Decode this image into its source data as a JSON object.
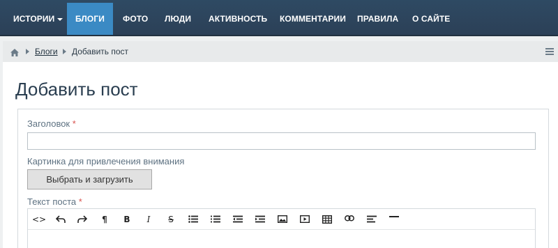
{
  "nav": {
    "items": [
      {
        "label": "ИСТОРИИ",
        "has_caret": true
      },
      {
        "label": "БЛОГИ",
        "active": true
      },
      {
        "label": "ФОТО"
      },
      {
        "label": "ЛЮДИ"
      },
      {
        "label": "АКТИВНОСТЬ"
      },
      {
        "label": "КОММЕНТАРИИ"
      },
      {
        "label": "ПРАВИЛА"
      },
      {
        "label": "О САЙТЕ"
      }
    ],
    "active_color": "#3b8ac4"
  },
  "breadcrumb": {
    "items": [
      "Блоги",
      "Добавить пост"
    ]
  },
  "page": {
    "title": "Добавить пост"
  },
  "form": {
    "title_label": "Заголовок",
    "required_mark": "*",
    "title_value": "",
    "image_label": "Картинка для привлечения внимания",
    "upload_button": "Выбрать и загрузить",
    "body_label": "Текст поста"
  },
  "editor": {
    "toolbar": [
      {
        "icon": "code-icon",
        "glyph": "<>"
      },
      {
        "icon": "undo-icon"
      },
      {
        "icon": "redo-icon"
      },
      {
        "icon": "paragraph-icon",
        "glyph": "¶"
      },
      {
        "icon": "bold-icon",
        "glyph": "B"
      },
      {
        "icon": "italic-icon",
        "glyph": "I"
      },
      {
        "icon": "strikethrough-icon",
        "glyph": "S"
      },
      {
        "icon": "bullet-list-icon"
      },
      {
        "icon": "numbered-list-icon"
      },
      {
        "icon": "outdent-icon"
      },
      {
        "icon": "indent-icon"
      },
      {
        "icon": "image-icon"
      },
      {
        "icon": "video-icon"
      },
      {
        "icon": "table-icon"
      },
      {
        "icon": "link-icon"
      },
      {
        "icon": "align-icon"
      },
      {
        "icon": "horizontal-rule-icon"
      }
    ]
  }
}
